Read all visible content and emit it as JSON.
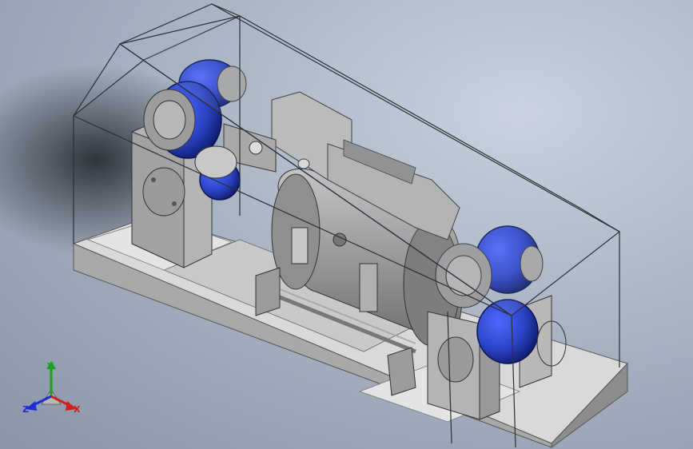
{
  "viewport": {
    "background_top": "#c9d2de",
    "background_bottom": "#8995a6"
  },
  "model": {
    "housing_glass_color": "#aeb9c9",
    "housing_edge_color": "#2b2f36",
    "base_color": "#d9d9d9",
    "metal_color": "#a7a7a7",
    "roller_color": "#2c45c8",
    "shadow_color": "#1a1e24"
  },
  "triad": {
    "x_label": "X",
    "y_label": "Y",
    "z_label": "Z",
    "x_color": "#d12020",
    "y_color": "#1aa21a",
    "z_color": "#1f2bd6"
  }
}
